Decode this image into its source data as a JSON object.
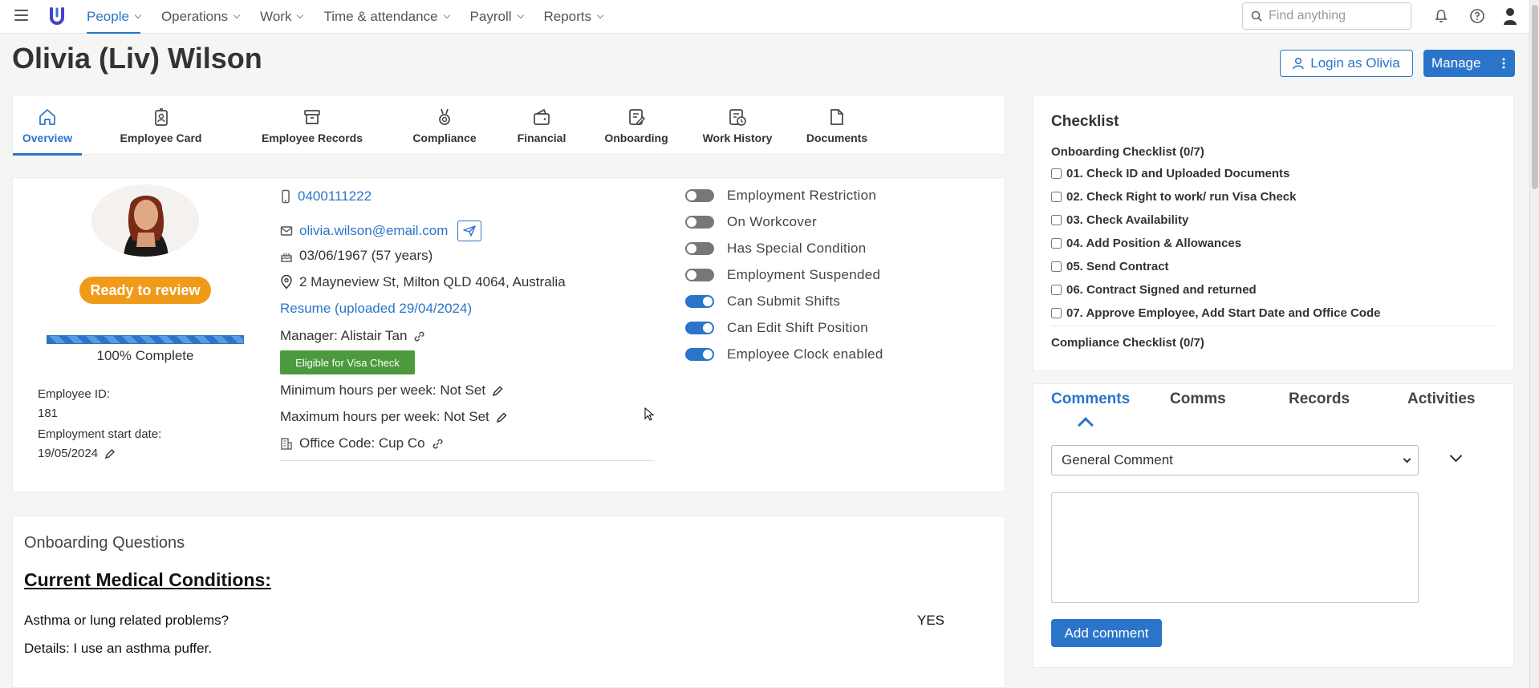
{
  "nav": {
    "items": [
      {
        "label": "People",
        "active": true
      },
      {
        "label": "Operations",
        "active": false
      },
      {
        "label": "Work",
        "active": false
      },
      {
        "label": "Time & attendance",
        "active": false
      },
      {
        "label": "Payroll",
        "active": false
      },
      {
        "label": "Reports",
        "active": false
      }
    ],
    "search_placeholder": "Find anything"
  },
  "header": {
    "title": "Olivia (Liv) Wilson",
    "login_label": "Login as Olivia",
    "manage_label": "Manage"
  },
  "tabs": [
    {
      "label": "Overview",
      "icon": "home-icon",
      "active": true
    },
    {
      "label": "Employee Card",
      "icon": "badge-icon",
      "active": false
    },
    {
      "label": "Employee Records",
      "icon": "archive-icon",
      "active": false
    },
    {
      "label": "Compliance",
      "icon": "medal-icon",
      "active": false
    },
    {
      "label": "Financial",
      "icon": "wallet-icon",
      "active": false
    },
    {
      "label": "Onboarding",
      "icon": "clipboard-edit-icon",
      "active": false
    },
    {
      "label": "Work History",
      "icon": "clock-document-icon",
      "active": false
    },
    {
      "label": "Documents",
      "icon": "document-icon",
      "active": false
    }
  ],
  "profile": {
    "status": "Ready to review",
    "progress_percent": 100,
    "progress_label": "100% Complete",
    "employee_id_label": "Employee ID:",
    "employee_id": "181",
    "start_date_label": "Employment start date:",
    "start_date": "19/05/2024",
    "phone": "0400111222",
    "email": "olivia.wilson@email.com",
    "dob": "03/06/1967 (57 years)",
    "address": "2 Mayneview St, Milton QLD 4064, Australia",
    "resume": "Resume (uploaded 29/04/2024)",
    "manager": "Manager: Alistair Tan",
    "visa_badge": "Eligible for Visa Check",
    "min_hours": "Minimum hours per week: Not Set",
    "max_hours": "Maximum hours per week: Not Set",
    "office_code": "Office Code: Cup Co"
  },
  "toggles": [
    {
      "label": "Employment Restriction",
      "on": false
    },
    {
      "label": "On Workcover",
      "on": false
    },
    {
      "label": "Has Special Condition",
      "on": false
    },
    {
      "label": "Employment Suspended",
      "on": false
    },
    {
      "label": "Can Submit Shifts",
      "on": true
    },
    {
      "label": "Can Edit Shift Position",
      "on": true
    },
    {
      "label": "Employee Clock enabled",
      "on": true
    }
  ],
  "onboarding": {
    "title": "Onboarding Questions",
    "heading": "Current Medical Conditions:",
    "question": "Asthma or lung related problems?",
    "answer": "YES",
    "details": "Details: I use an asthma puffer."
  },
  "checklist": {
    "title": "Checklist",
    "onboarding_title": "Onboarding Checklist (0/7)",
    "items": [
      "01. Check ID and Uploaded Documents",
      "02. Check Right to work/ run Visa Check",
      "03. Check Availability",
      "04. Add Position & Allowances",
      "05. Send Contract",
      "06. Contract Signed and returned",
      "07. Approve Employee, Add Start Date and Office Code"
    ],
    "compliance_title": "Compliance Checklist (0/7)"
  },
  "comments": {
    "tabs": [
      "Comments",
      "Comms",
      "Records",
      "Activities"
    ],
    "select_value": "General Comment",
    "add_label": "Add comment"
  },
  "colors": {
    "accent": "#2a75c9",
    "status": "#f09a1a",
    "visa": "#4c9a3e"
  }
}
